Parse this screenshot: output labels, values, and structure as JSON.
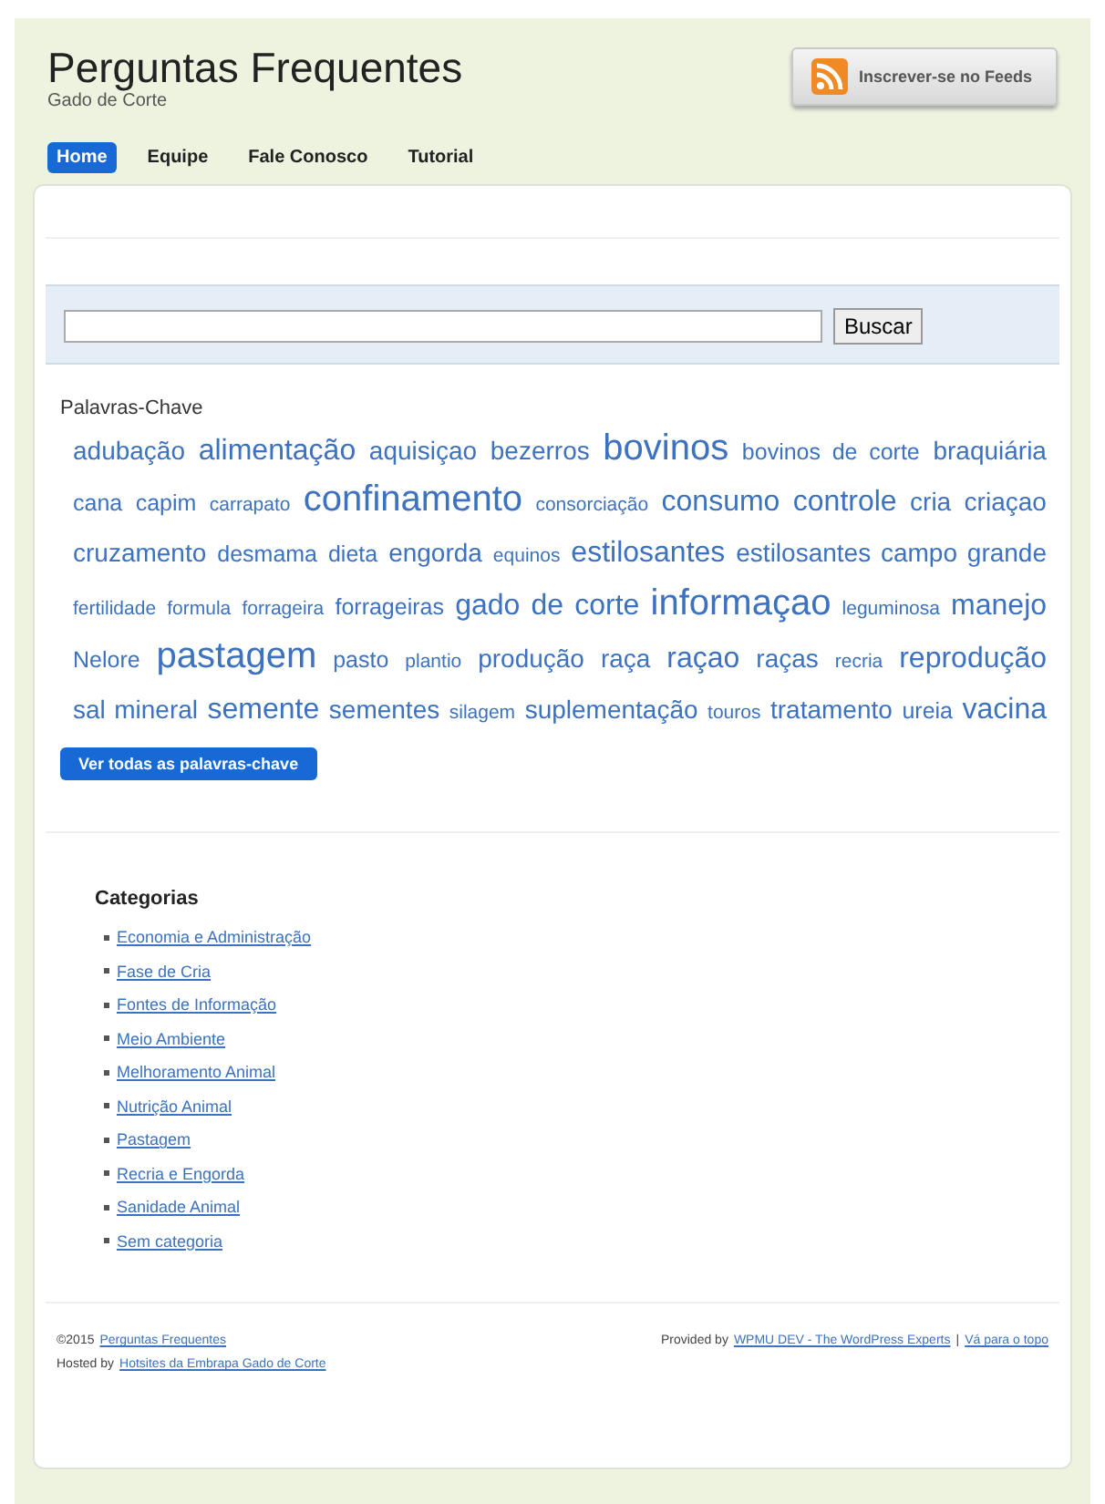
{
  "site": {
    "title": "Perguntas Frequentes",
    "tagline": "Gado de Corte"
  },
  "feed_button": {
    "label": "Inscrever-se no Feeds"
  },
  "nav": [
    {
      "label": "Home",
      "selected": true
    },
    {
      "label": "Equipe",
      "selected": false
    },
    {
      "label": "Fale Conosco",
      "selected": false
    },
    {
      "label": "Tutorial",
      "selected": false
    }
  ],
  "search": {
    "button": "Buscar"
  },
  "tags": {
    "heading": "Palavras-Chave",
    "items": [
      {
        "label": "adubação",
        "kind": "medium"
      },
      {
        "label": "alimentação",
        "kind": "large"
      },
      {
        "label": "aquisiçao",
        "kind": "medium"
      },
      {
        "label": "bezerros",
        "kind": "medium"
      },
      {
        "label": "bovinos",
        "kind": "huge"
      },
      {
        "label": "bovinos de corte",
        "kind": "small"
      },
      {
        "label": "braquiária",
        "kind": "medium"
      },
      {
        "label": "cana",
        "kind": "small"
      },
      {
        "label": "capim",
        "kind": "small"
      },
      {
        "label": "carrapato",
        "kind": "tiny"
      },
      {
        "label": "confinamento",
        "kind": "huge"
      },
      {
        "label": "consorciação",
        "kind": "tiny"
      },
      {
        "label": "consumo",
        "kind": "large"
      },
      {
        "label": "controle",
        "kind": "large"
      },
      {
        "label": "cria",
        "kind": "medium"
      },
      {
        "label": "criaçao",
        "kind": "medium"
      },
      {
        "label": "cruzamento",
        "kind": "medium"
      },
      {
        "label": "desmama",
        "kind": "small"
      },
      {
        "label": "dieta",
        "kind": "small"
      },
      {
        "label": "engorda",
        "kind": "medium"
      },
      {
        "label": "equinos",
        "kind": "tiny"
      },
      {
        "label": "estilosantes",
        "kind": "large"
      },
      {
        "label": "estilosantes campo grande",
        "kind": "medium"
      },
      {
        "label": "fertilidade",
        "kind": "tiny"
      },
      {
        "label": "formula",
        "kind": "tiny"
      },
      {
        "label": "forrageira",
        "kind": "tiny"
      },
      {
        "label": "forrageiras",
        "kind": "small"
      },
      {
        "label": "gado de corte",
        "kind": "large"
      },
      {
        "label": "informaçao",
        "kind": "huge"
      },
      {
        "label": "leguminosa",
        "kind": "tiny"
      },
      {
        "label": "manejo",
        "kind": "large"
      },
      {
        "label": "Nelore",
        "kind": "small"
      },
      {
        "label": "pastagem",
        "kind": "huge"
      },
      {
        "label": "pasto",
        "kind": "small"
      },
      {
        "label": "plantio",
        "kind": "tiny"
      },
      {
        "label": "produção",
        "kind": "medium"
      },
      {
        "label": "raça",
        "kind": "medium"
      },
      {
        "label": "raçao",
        "kind": "large"
      },
      {
        "label": "raças",
        "kind": "medium"
      },
      {
        "label": "recria",
        "kind": "tiny"
      },
      {
        "label": "reprodução",
        "kind": "large"
      },
      {
        "label": "sal mineral",
        "kind": "medium"
      },
      {
        "label": "semente",
        "kind": "large"
      },
      {
        "label": "sementes",
        "kind": "medium"
      },
      {
        "label": "silagem",
        "kind": "tiny"
      },
      {
        "label": "suplementação",
        "kind": "medium"
      },
      {
        "label": "touros",
        "kind": "tiny"
      },
      {
        "label": "tratamento",
        "kind": "medium"
      },
      {
        "label": "ureia",
        "kind": "small"
      },
      {
        "label": "vacina",
        "kind": "large"
      }
    ],
    "all_button": "Ver todas as palavras-chave"
  },
  "categories": {
    "heading": "Categorias",
    "items": [
      "Economia e Administração",
      "Fase de Cria",
      "Fontes de Informação",
      "Meio Ambiente",
      "Melhoramento Animal",
      "Nutrição Animal",
      "Pastagem",
      "Recria e Engorda",
      "Sanidade Animal",
      "Sem categoria"
    ]
  },
  "footer": {
    "copyright": "©2015",
    "site_link": "Perguntas Frequentes",
    "hosted_prefix": "Hosted by",
    "hosted_link": "Hotsites da Embrapa Gado de Corte",
    "provided_prefix": "Provided by",
    "provided_link": "WPMU DEV - The WordPress Experts",
    "separator": "|",
    "top_link": "Vá para o topo"
  }
}
